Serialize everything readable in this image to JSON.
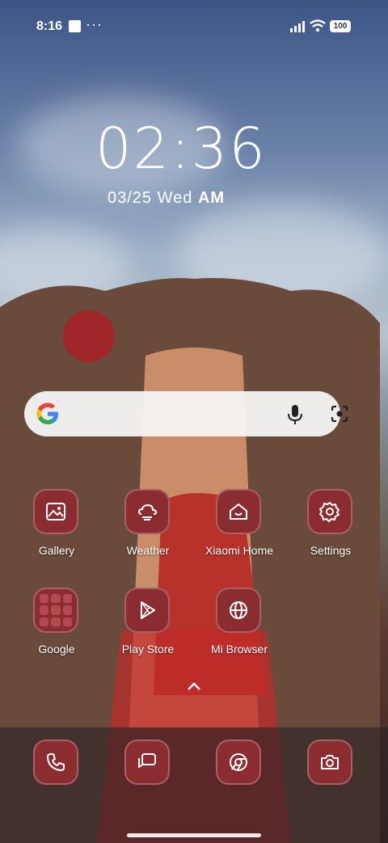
{
  "status_bar": {
    "time": "8:16",
    "more": "···",
    "battery": "100"
  },
  "lockscreen": {
    "clock": "02:36",
    "date": "03/25 Wed",
    "ampm": "AM"
  },
  "apps": [
    {
      "label": "Gallery",
      "icon": "gallery-icon"
    },
    {
      "label": "Weather",
      "icon": "weather-icon"
    },
    {
      "label": "Xiaomi Home",
      "icon": "home-icon"
    },
    {
      "label": "Settings",
      "icon": "gear-icon"
    },
    {
      "label": "Google",
      "icon": "folder-icon"
    },
    {
      "label": "Play Store",
      "icon": "play-icon"
    },
    {
      "label": "Mi Browser",
      "icon": "globe-icon"
    }
  ],
  "dock": [
    {
      "icon": "phone-icon"
    },
    {
      "icon": "messages-icon"
    },
    {
      "icon": "chrome-icon"
    },
    {
      "icon": "camera-icon"
    }
  ],
  "colors": {
    "icon_bg": "#8b2c30",
    "search_bg": "#f5f5f5"
  }
}
